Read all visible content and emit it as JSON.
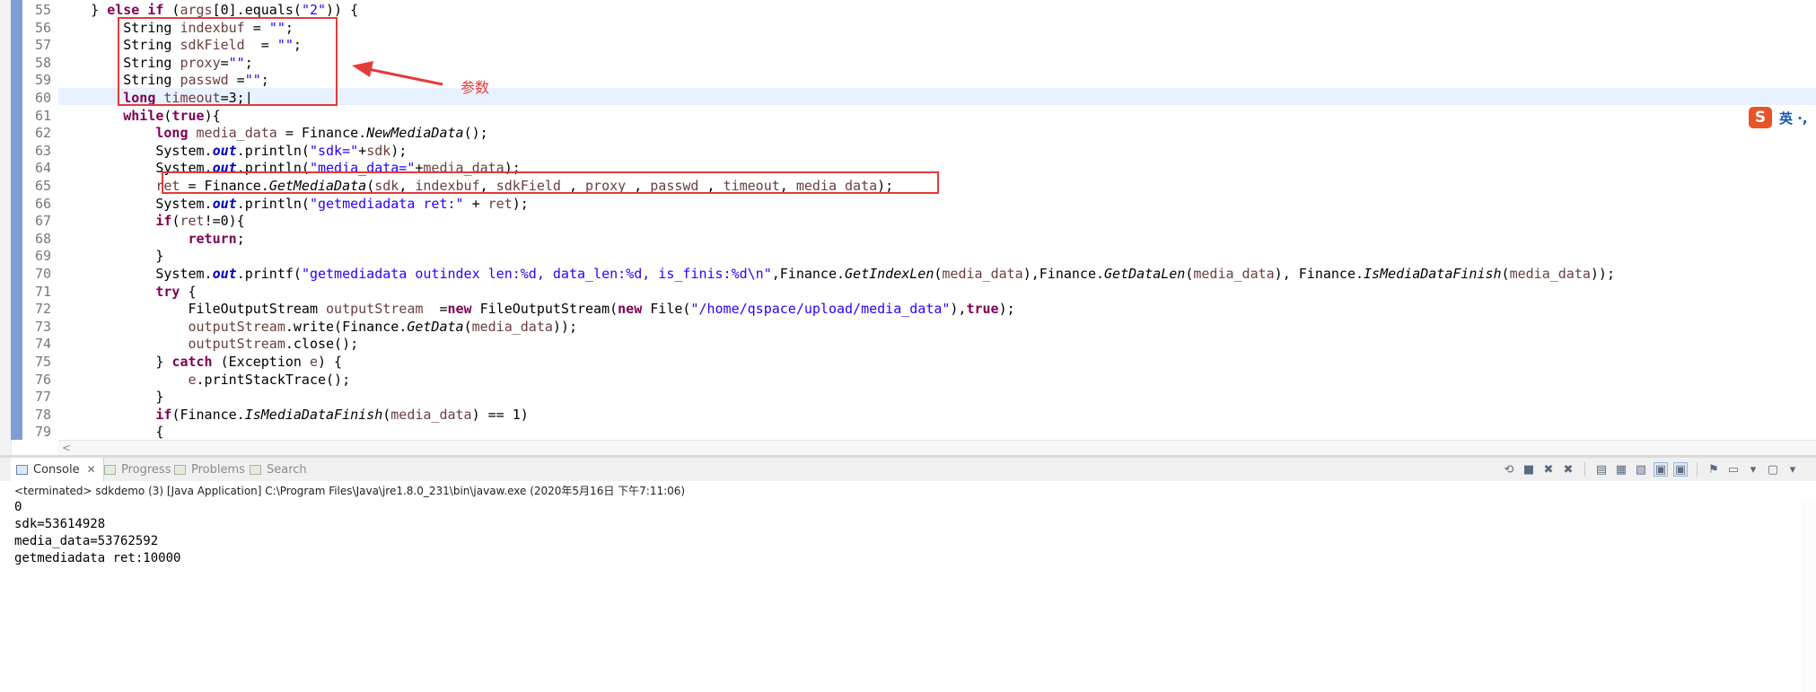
{
  "code_lines": [
    {
      "num": "55",
      "html": "    } <span class=\"kw\">else</span> <span class=\"kw\">if</span> (<span class=\"var\">args</span>[0].equals(<span class=\"str\">\"2\"</span>)) {"
    },
    {
      "num": "56",
      "html": "        String <span class=\"var\">indexbuf</span> = <span class=\"str\">\"\"</span>;"
    },
    {
      "num": "57",
      "html": "        String <span class=\"var\">sdkField</span>  = <span class=\"str\">\"\"</span>;"
    },
    {
      "num": "58",
      "html": "        String <span class=\"var\">proxy</span>=<span class=\"str\">\"\"</span>;"
    },
    {
      "num": "59",
      "html": "        String <span class=\"var\">passwd</span> =<span class=\"str\">\"\"</span>;"
    },
    {
      "num": "60",
      "html": "        <span class=\"kw\">long</span> <span class=\"var\">timeout</span>=3;|"
    },
    {
      "num": "61",
      "html": "        <span class=\"kw\">while</span>(<span class=\"kw\">true</span>){"
    },
    {
      "num": "62",
      "html": "            <span class=\"kw\">long</span> <span class=\"var\">media_data</span> = Finance.<span class=\"mth\">NewMediaData</span>();"
    },
    {
      "num": "63",
      "html": "            System.<span class=\"fld\">out</span>.println(<span class=\"str\">\"sdk=\"</span>+<span class=\"var\">sdk</span>);"
    },
    {
      "num": "64",
      "html": "            System.<span class=\"fld\">out</span>.println(<span class=\"str\">\"media_data=\"</span>+<span class=\"var\">media_data</span>);"
    },
    {
      "num": "65",
      "html": "            <span class=\"var\">ret</span> = Finance.<span class=\"mth\">GetMediaData</span>(<span class=\"var\">sdk</span>, <span class=\"var\">indexbuf</span>, <span class=\"var\">sdkField</span> , <span class=\"var\">proxy</span> , <span class=\"var\">passwd</span> , <span class=\"var\">timeout</span>, <span class=\"var\">media_data</span>);"
    },
    {
      "num": "66",
      "html": "            System.<span class=\"fld\">out</span>.println(<span class=\"str\">\"getmediadata ret:\"</span> + <span class=\"var\">ret</span>);"
    },
    {
      "num": "67",
      "html": "            <span class=\"kw\">if</span>(<span class=\"var\">ret</span>!=0){"
    },
    {
      "num": "68",
      "html": "                <span class=\"kw\">return</span>;"
    },
    {
      "num": "69",
      "html": "            }"
    },
    {
      "num": "70",
      "html": "            System.<span class=\"fld\">out</span>.printf(<span class=\"str\">\"getmediadata outindex len:%d, data_len:%d, is_finis:%d\\n\"</span>,Finance.<span class=\"mth\">GetIndexLen</span>(<span class=\"var\">media_data</span>),Finance.<span class=\"mth\">GetDataLen</span>(<span class=\"var\">media_data</span>), Finance.<span class=\"mth\">IsMediaDataFinish</span>(<span class=\"var\">media_data</span>));"
    },
    {
      "num": "71",
      "html": "            <span class=\"kw\">try</span> {"
    },
    {
      "num": "72",
      "html": "                FileOutputStream <span class=\"var\">outputStream</span>  =<span class=\"kw\">new</span> FileOutputStream(<span class=\"kw\">new</span> File(<span class=\"str\">\"/home/qspace/upload/media_data\"</span>),<span class=\"kw\">true</span>);"
    },
    {
      "num": "73",
      "html": "                <span class=\"var\">outputStream</span>.write(Finance.<span class=\"mth\">GetData</span>(<span class=\"var\">media_data</span>));"
    },
    {
      "num": "74",
      "html": "                <span class=\"var\">outputStream</span>.close();"
    },
    {
      "num": "75",
      "html": "            } <span class=\"kw\">catch</span> (Exception <span class=\"var\">e</span>) {"
    },
    {
      "num": "76",
      "html": "                <span class=\"var\">e</span>.printStackTrace();"
    },
    {
      "num": "77",
      "html": "            }"
    },
    {
      "num": "78",
      "html": "            <span class=\"kw\">if</span>(Finance.<span class=\"mth\">IsMediaDataFinish</span>(<span class=\"var\">media_data</span>) == 1)"
    },
    {
      "num": "79",
      "html": "            {"
    }
  ],
  "annotation": {
    "label": "参数"
  },
  "ime": {
    "icon_letter": "S",
    "text": "英 ·,"
  },
  "console": {
    "tabs": [
      {
        "label": "Console",
        "active": true
      },
      {
        "label": "Progress",
        "active": false
      },
      {
        "label": "Problems",
        "active": false
      },
      {
        "label": "Search",
        "active": false
      }
    ],
    "terminated": "<terminated> sdkdemo (3) [Java Application] C:\\Program Files\\Java\\jre1.8.0_231\\bin\\javaw.exe (2020年5月16日 下午7:11:06)",
    "output": [
      "0",
      "sdk=53614928",
      "media_data=53762592",
      "getmediadata ret:10000"
    ]
  },
  "colors": {
    "annotation_red": "#e43b3b",
    "keyword": "#7f0055",
    "string": "#2a00ff",
    "line_highlight": "#e8f2fe"
  }
}
